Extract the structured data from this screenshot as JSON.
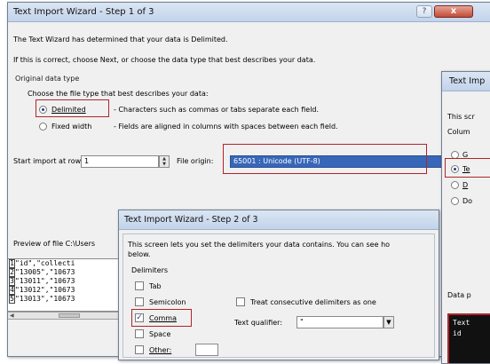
{
  "colors": {
    "highlight_border": "#b0242a",
    "selection_blue": "#3867b9",
    "title_gradient": "#c2d3ea"
  },
  "step1": {
    "title": "Text Import Wizard - Step 1 of 3",
    "help_icon": "help-question-icon",
    "close_icon": "close-x-icon",
    "intro_1": "The Text Wizard has determined that your data is Delimited.",
    "intro_2": "If this is correct, choose Next, or choose the data type that best describes your data.",
    "group_label": "Original data type",
    "choose_label": "Choose the file type that best describes your data:",
    "options": [
      {
        "label": "Delimited",
        "description": "- Characters such as commas or tabs separate each field.",
        "selected": true
      },
      {
        "label": "Fixed width",
        "description": "- Fields are aligned in columns with spaces between each field.",
        "selected": false
      }
    ],
    "start_row_label": "Start import at row:",
    "start_row_value": "1",
    "file_origin_label": "File origin:",
    "file_origin_value": "65001 : Unicode (UTF-8)",
    "preview_label": "Preview of file C:\\Users",
    "preview_lines": [
      {
        "num": "1",
        "text": "\"id\",\"collecti"
      },
      {
        "num": "2",
        "text": "\"13005\",\"10673"
      },
      {
        "num": "3",
        "text": "\"13011\",\"10673"
      },
      {
        "num": "4",
        "text": "\"13012\",\"10673"
      },
      {
        "num": "5",
        "text": "\"13013\",\"10673"
      }
    ]
  },
  "step2": {
    "title": "Text Import Wizard - Step 2 of 3",
    "intro_1": "This screen lets you set the delimiters your data contains.  You can see ho",
    "intro_2": "below.",
    "delimiters_label": "Delimiters",
    "delimiters": [
      {
        "label": "Tab",
        "checked": false
      },
      {
        "label": "Semicolon",
        "checked": false
      },
      {
        "label": "Comma",
        "checked": true
      },
      {
        "label": "Space",
        "checked": false
      },
      {
        "label": "Other:",
        "checked": false
      }
    ],
    "consecutive_label": "Treat consecutive delimiters as one",
    "qualifier_label": "Text qualifier:",
    "qualifier_value": "\""
  },
  "step3": {
    "title": "Text Imp",
    "intro": "This scr",
    "group_label": "Colum",
    "options": [
      {
        "label": "G",
        "selected": false
      },
      {
        "label": "Te",
        "selected": true
      },
      {
        "label": "D",
        "selected": false
      },
      {
        "label": "Do",
        "selected": false
      }
    ],
    "data_label": "Data p",
    "preview_lines": [
      "Text",
      "id"
    ]
  }
}
